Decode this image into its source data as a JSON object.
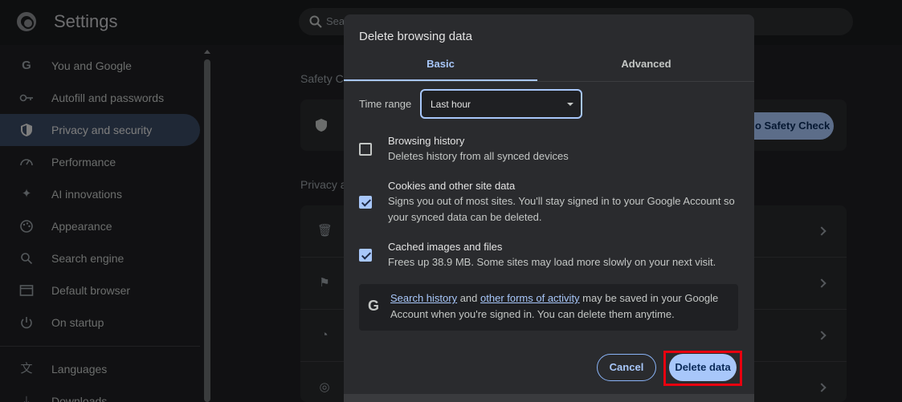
{
  "app": {
    "title": "Settings"
  },
  "search": {
    "placeholder": "Sea"
  },
  "sidebar": {
    "items": [
      {
        "label": "You and Google",
        "icon": "google-icon"
      },
      {
        "label": "Autofill and passwords",
        "icon": "key-icon"
      },
      {
        "label": "Privacy and security",
        "icon": "shield-icon",
        "active": true
      },
      {
        "label": "Performance",
        "icon": "speedometer-icon"
      },
      {
        "label": "AI innovations",
        "icon": "sparkle-icon"
      },
      {
        "label": "Appearance",
        "icon": "palette-icon"
      },
      {
        "label": "Search engine",
        "icon": "search-icon"
      },
      {
        "label": "Default browser",
        "icon": "browser-icon"
      },
      {
        "label": "On startup",
        "icon": "power-icon"
      },
      {
        "label": "Languages",
        "icon": "translate-icon"
      },
      {
        "label": "Downloads",
        "icon": "download-icon"
      }
    ]
  },
  "main": {
    "safety_check_heading": "Safety C",
    "privacy_heading": "Privacy a",
    "safety_check_button": "o Safety Check"
  },
  "dialog": {
    "title": "Delete browsing data",
    "tabs": {
      "basic": "Basic",
      "advanced": "Advanced"
    },
    "time_range": {
      "label": "Time range",
      "value": "Last hour"
    },
    "options": [
      {
        "title": "Browsing history",
        "description": "Deletes history from all synced devices",
        "checked": false
      },
      {
        "title": "Cookies and other site data",
        "description": "Signs you out of most sites. You'll stay signed in to your Google Account so your synced data can be deleted.",
        "checked": true
      },
      {
        "title": "Cached images and files",
        "description": "Frees up 38.9 MB. Some sites may load more slowly on your next visit.",
        "checked": true
      }
    ],
    "info": {
      "link1": "Search history",
      "and": " and ",
      "link2": "other forms of activity",
      "rest": " may be saved in your Google Account when you're signed in. You can delete them anytime."
    },
    "buttons": {
      "cancel": "Cancel",
      "delete": "Delete data"
    }
  },
  "colors": {
    "accent": "#a8c7fa",
    "highlight": "#e8000f",
    "background": "#1f2023",
    "dialog": "#2a2b2e"
  }
}
